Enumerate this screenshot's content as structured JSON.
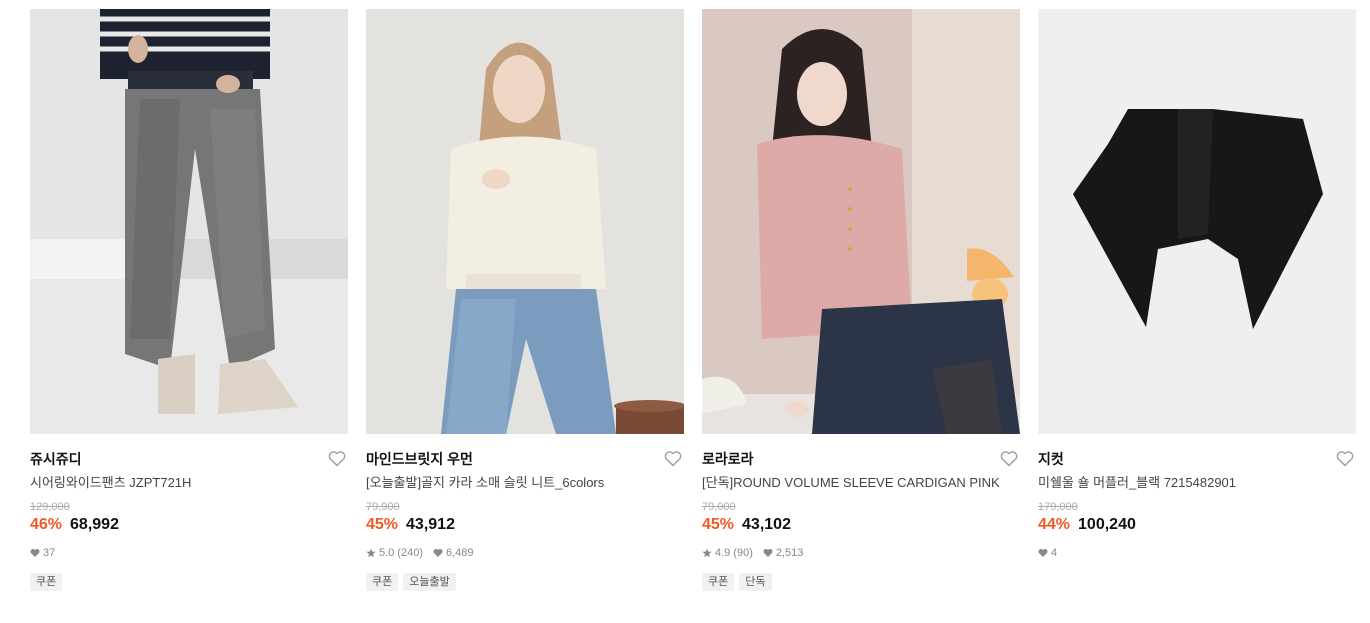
{
  "products": [
    {
      "brand": "쥬시쥬디",
      "name": "시어링와이드팬츠 JZPT721H",
      "original_price": "129,000",
      "discount": "46%",
      "price": "68,992",
      "rating": null,
      "review_count": null,
      "likes": "37",
      "tags": [
        "쿠폰"
      ],
      "image_alt": "knit jogger pants with beige boots"
    },
    {
      "brand": "마인드브릿지 우먼",
      "name": "[오늘출발]골지 카라 소매 슬릿 니트_6colors",
      "original_price": "79,900",
      "discount": "45%",
      "price": "43,912",
      "rating": "5.0",
      "review_count": "(240)",
      "likes": "6,489",
      "tags": [
        "쿠폰",
        "오늘출발"
      ],
      "image_alt": "model in white ribbed knit and jeans"
    },
    {
      "brand": "로라로라",
      "name": "[단독]ROUND VOLUME SLEEVE CARDIGAN PINK",
      "original_price": "79,000",
      "discount": "45%",
      "price": "43,102",
      "rating": "4.9",
      "review_count": "(90)",
      "likes": "2,513",
      "tags": [
        "쿠폰",
        "단독"
      ],
      "image_alt": "model in pink cardigan and navy skirt"
    },
    {
      "brand": "지컷",
      "name": "미쉘울 숄 머플러_블랙 7215482901",
      "original_price": "179,000",
      "discount": "44%",
      "price": "100,240",
      "rating": null,
      "review_count": null,
      "likes": "4",
      "tags": [],
      "image_alt": "black wool shawl muffler"
    }
  ],
  "colors": {
    "discount": "#f05a23",
    "text": "#111111",
    "muted": "#888888",
    "tag_bg": "#f1f1f1"
  }
}
